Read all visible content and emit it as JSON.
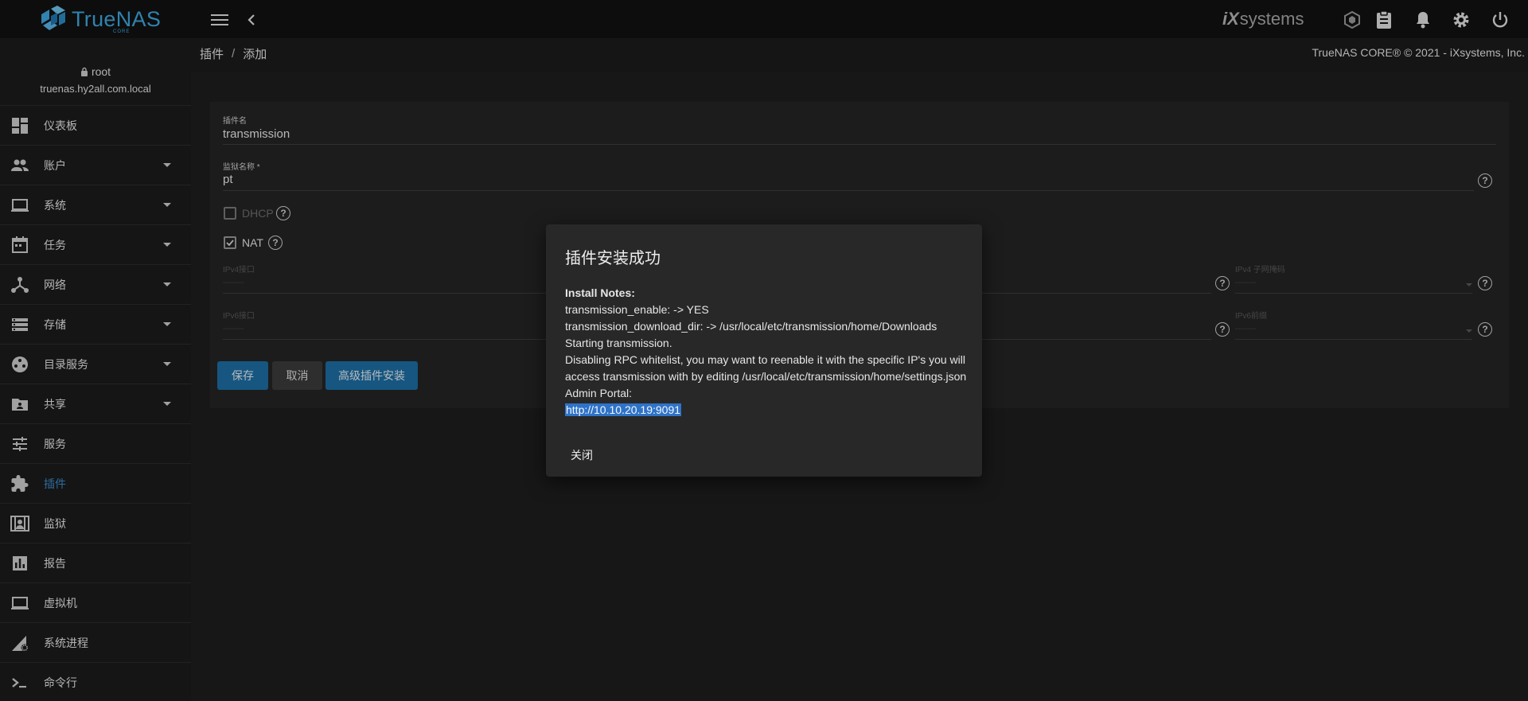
{
  "topbar": {
    "logo_text": "TrueNAS",
    "logo_sub": "CORE",
    "vendor_ix": "iX",
    "vendor_systems": "systems"
  },
  "user": {
    "name": "root",
    "host": "truenas.hy2all.com.local"
  },
  "sidebar": {
    "items": [
      {
        "label": "仪表板",
        "icon": "dashboard-icon",
        "expandable": false
      },
      {
        "label": "账户",
        "icon": "people-icon",
        "expandable": true
      },
      {
        "label": "系统",
        "icon": "laptop-icon",
        "expandable": true
      },
      {
        "label": "任务",
        "icon": "calendar-icon",
        "expandable": true
      },
      {
        "label": "网络",
        "icon": "network-icon",
        "expandable": true
      },
      {
        "label": "存储",
        "icon": "storage-icon",
        "expandable": true
      },
      {
        "label": "目录服务",
        "icon": "directory-icon",
        "expandable": true
      },
      {
        "label": "共享",
        "icon": "folder-share-icon",
        "expandable": true
      },
      {
        "label": "服务",
        "icon": "tune-icon",
        "expandable": false
      },
      {
        "label": "插件",
        "icon": "puzzle-icon",
        "expandable": false,
        "active": true
      },
      {
        "label": "监狱",
        "icon": "jail-icon",
        "expandable": false
      },
      {
        "label": "报告",
        "icon": "chart-icon",
        "expandable": false
      },
      {
        "label": "虚拟机",
        "icon": "computer-icon",
        "expandable": false
      },
      {
        "label": "系统进程",
        "icon": "process-icon",
        "expandable": false
      },
      {
        "label": "命令行",
        "icon": "shell-icon",
        "expandable": false
      }
    ]
  },
  "breadcrumb": {
    "parent": "插件",
    "separator": "/",
    "current": "添加"
  },
  "copyright": "TrueNAS CORE® © 2021 - iXsystems, Inc.",
  "form": {
    "plugin_name_label": "插件名",
    "plugin_name_value": "transmission",
    "jail_name_label": "监狱名称 *",
    "jail_name_value": "pt",
    "dhcp_label": "DHCP",
    "dhcp_checked": false,
    "nat_label": "NAT",
    "nat_checked": true,
    "ipv4_interface_label": "IPv4接口",
    "ipv4_interface_value": "--------",
    "ipv4_netmask_label": "IPv4 子网掩码",
    "ipv4_netmask_value": "--------",
    "ipv6_interface_label": "IPv6接口",
    "ipv6_interface_value": "--------",
    "ipv6_prefix_label": "IPv6前缀",
    "ipv6_prefix_value": "--------",
    "save_button": "保存",
    "cancel_button": "取消",
    "advanced_button": "高级插件安装"
  },
  "dialog": {
    "title": "插件安装成功",
    "notes_heading": "Install Notes:",
    "lines": [
      "transmission_enable: -> YES",
      "transmission_download_dir: -> /usr/local/etc/transmission/home/Downloads",
      "Starting transmission.",
      "Disabling RPC whitelist, you may want to reenable it with the specific IP's you will access transmission with by editing /usr/local/etc/transmission/home/settings.json",
      "Admin Portal:"
    ],
    "portal_link": "http://10.10.20.19:9091",
    "close_button": "关闭"
  },
  "colors": {
    "accent": "#3ea7e0",
    "primary_button": "#1d6fa5",
    "active_nav": "#3d8bcb",
    "link_highlight": "#2f73c8"
  }
}
